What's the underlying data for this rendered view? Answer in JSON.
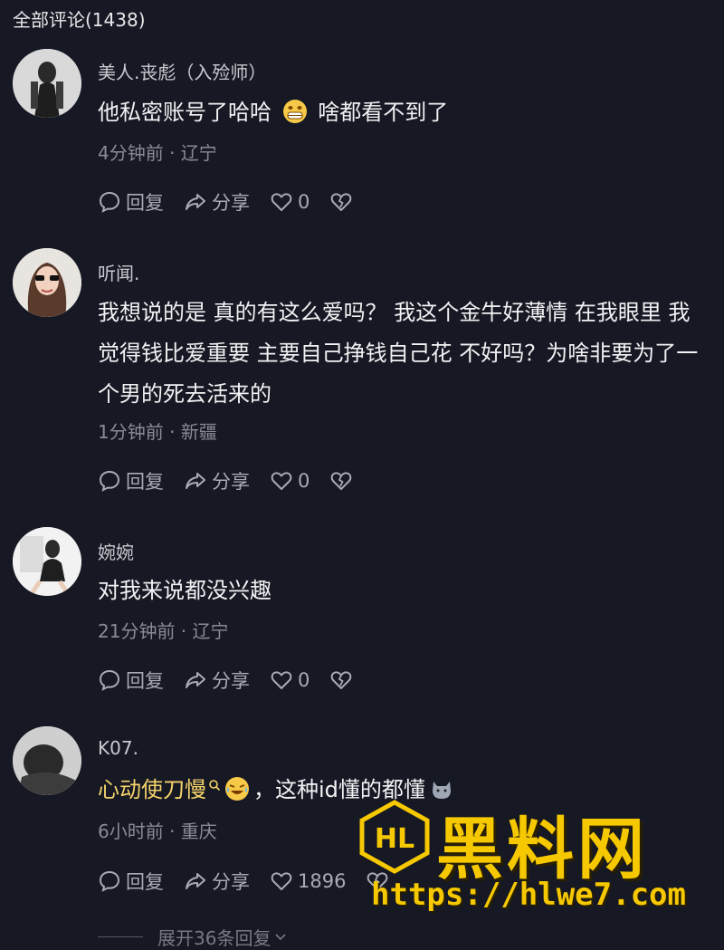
{
  "header": {
    "title": "全部评论(1438)"
  },
  "comments": [
    {
      "username": "美人.丧彪（入殓师）",
      "text_before": "他私密账号了哈哈 ",
      "text_after": " 啥都看不到了",
      "meta": "4分钟前 · 辽宁",
      "reply_label": "回复",
      "share_label": "分享",
      "likes": "0"
    },
    {
      "username": "听闻.",
      "text": "我想说的是 真的有这么爱吗？ 我这个金牛好薄情 在我眼里 我觉得钱比爱重要 主要自己挣钱自己花 不好吗？为啥非要为了一个男的死去活来的",
      "meta": "1分钟前 · 新疆",
      "reply_label": "回复",
      "share_label": "分享",
      "likes": "0"
    },
    {
      "username": "婉婉",
      "text": "对我来说都没兴趣",
      "meta": "21分钟前 · 辽宁",
      "reply_label": "回复",
      "share_label": "分享",
      "likes": "0"
    },
    {
      "username": "K07.",
      "mention": "心动使刀慢",
      "text_after": "，这种id懂的都懂",
      "meta": "6小时前 · 重庆",
      "reply_label": "回复",
      "share_label": "分享",
      "likes": "1896"
    }
  ],
  "expand_label": "展开36条回复",
  "watermark": {
    "title": "黑料网",
    "url": "https://hlwe7.com",
    "logo": "HL"
  },
  "icons": [
    "comment-bubble-icon",
    "share-arrow-icon",
    "heart-icon",
    "broken-heart-icon",
    "search-icon",
    "chevron-down-icon"
  ],
  "colors": {
    "background": "#161823",
    "mention": "#f5d36b",
    "watermark": "#f6c800"
  }
}
